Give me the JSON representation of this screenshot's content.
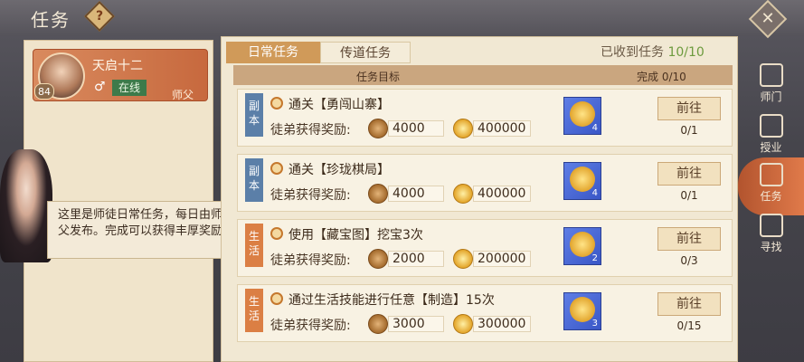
{
  "header": {
    "title": "任务",
    "help_symbol": "?",
    "close_symbol": "✕"
  },
  "profile": {
    "name": "天启十二",
    "level": "84",
    "gender_symbol": "♂",
    "status": "在线",
    "role": "师父"
  },
  "dialog": {
    "text": "这里是师徒日常任务，每日由师父发布。完成可以获得丰厚奖励"
  },
  "tabs": [
    {
      "label": "日常任务",
      "active": true
    },
    {
      "label": "传道任务",
      "active": false
    }
  ],
  "received": {
    "label": "已收到任务",
    "count": "10/10"
  },
  "table_header": {
    "goal": "任务目标",
    "done": "完成 0/10"
  },
  "tasks": [
    {
      "tag": "副本",
      "tag_color": "#5b7fa8",
      "name": "通关【勇闯山寨】",
      "reward_label": "徒弟获得奖励:",
      "copper": "4000",
      "gold": "400000",
      "item_count": "4",
      "button": "前往",
      "progress": "0/1"
    },
    {
      "tag": "副本",
      "tag_color": "#5b7fa8",
      "name": "通关【珍珑棋局】",
      "reward_label": "徒弟获得奖励:",
      "copper": "4000",
      "gold": "400000",
      "item_count": "4",
      "button": "前往",
      "progress": "0/1"
    },
    {
      "tag": "生活",
      "tag_color": "#db7f44",
      "name": "使用【藏宝图】挖宝3次",
      "reward_label": "徒弟获得奖励:",
      "copper": "2000",
      "gold": "200000",
      "item_count": "2",
      "button": "前往",
      "progress": "0/3"
    },
    {
      "tag": "生活",
      "tag_color": "#db7f44",
      "name": "通过生活技能进行任意【制造】15次",
      "reward_label": "徒弟获得奖励:",
      "copper": "3000",
      "gold": "300000",
      "item_count": "3",
      "button": "前往",
      "progress": "0/15"
    }
  ],
  "right_nav": [
    {
      "label": "师门",
      "icon": "sect-icon",
      "active": false
    },
    {
      "label": "授业",
      "icon": "book-icon",
      "active": false
    },
    {
      "label": "任务",
      "icon": "task-icon",
      "active": true
    },
    {
      "label": "寻找",
      "icon": "search-icon",
      "active": false
    }
  ]
}
